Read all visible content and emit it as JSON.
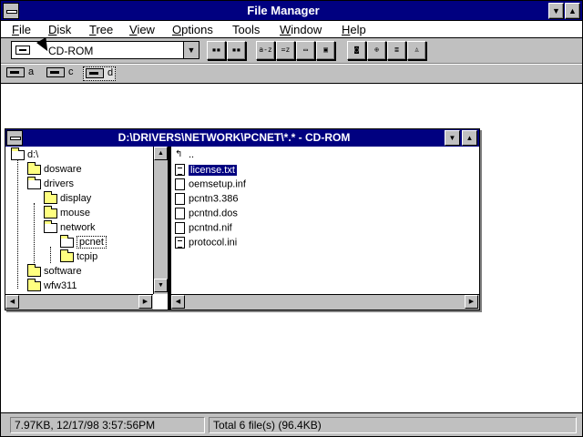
{
  "app": {
    "title": "File Manager"
  },
  "menu": [
    {
      "underline": "F",
      "rest": "ile"
    },
    {
      "underline": "D",
      "rest": "isk"
    },
    {
      "underline": "T",
      "rest": "ree"
    },
    {
      "underline": "V",
      "rest": "iew"
    },
    {
      "underline": "O",
      "rest": "ptions"
    },
    {
      "underline": "",
      "rest": "Tools"
    },
    {
      "underline": "W",
      "rest": "indow"
    },
    {
      "underline": "H",
      "rest": "elp"
    }
  ],
  "toolbar": {
    "drive_select": "CD-ROM"
  },
  "drives": [
    {
      "letter": "a"
    },
    {
      "letter": "c"
    },
    {
      "letter": "d"
    }
  ],
  "child": {
    "title": "D:\\DRIVERS\\NETWORK\\PCNET\\*.* - CD-ROM",
    "tree": [
      "d:\\",
      "dosware",
      "drivers",
      "display",
      "mouse",
      "network",
      "pcnet",
      "tcpip",
      "software",
      "wfw311"
    ],
    "files": [
      "..",
      "license.txt",
      "oemsetup.inf",
      "pcntn3.386",
      "pcntnd.dos",
      "pcntnd.nif",
      "protocol.ini"
    ]
  },
  "status": {
    "selected": "7.97KB, 12/17/98 3:57:56PM",
    "total": "Total 6 file(s) (96.4KB)"
  }
}
